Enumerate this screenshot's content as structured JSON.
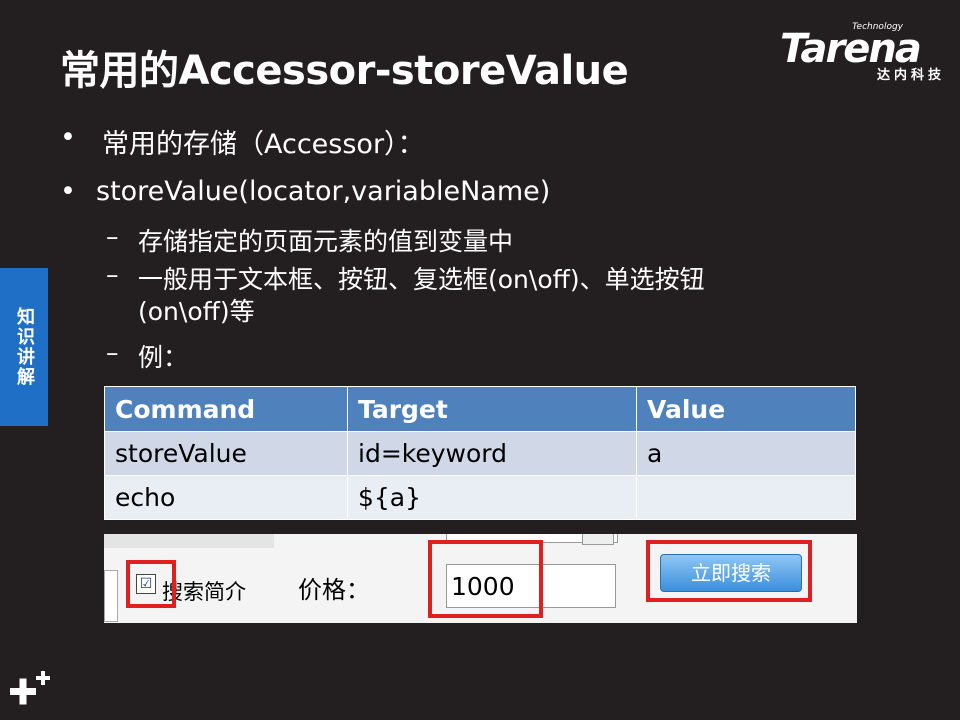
{
  "slide": {
    "title": "常用的Accessor-storeValue",
    "logo": {
      "wordmark": "Tarena",
      "tagline": "Technology",
      "cn": "达内科技"
    },
    "side_tab": "知识讲解",
    "bullets": [
      {
        "dot": "•",
        "text": "常用的存储（Accessor）："
      },
      {
        "dot": "•",
        "text": "storeValue(locator,variableName)"
      }
    ],
    "subpoints": [
      {
        "dash": "–",
        "text": "存储指定的页面元素的值到变量中"
      },
      {
        "dash": "–",
        "text": "一般用于文本框、按钮、复选框(on\\off)、单选按钮"
      },
      {
        "dash": "",
        "text": "(on\\off)等"
      },
      {
        "dash": "–",
        "text": "例："
      }
    ],
    "table": {
      "headers": [
        "Command",
        "Target",
        "Value"
      ],
      "rows": [
        [
          "storeValue",
          "id=keyword",
          "a"
        ],
        [
          "echo",
          "${a}",
          ""
        ]
      ]
    },
    "screenshot": {
      "checkbox_mark": "☑",
      "checkbox_label": "搜索简介",
      "price_label": "价格：",
      "price_value": "1000",
      "search_button": "立即搜索"
    },
    "colors": {
      "background": "#231f20",
      "accent_blue": "#1f6fc7",
      "table_header": "#4f81bd",
      "highlight_red": "#e02020"
    }
  }
}
